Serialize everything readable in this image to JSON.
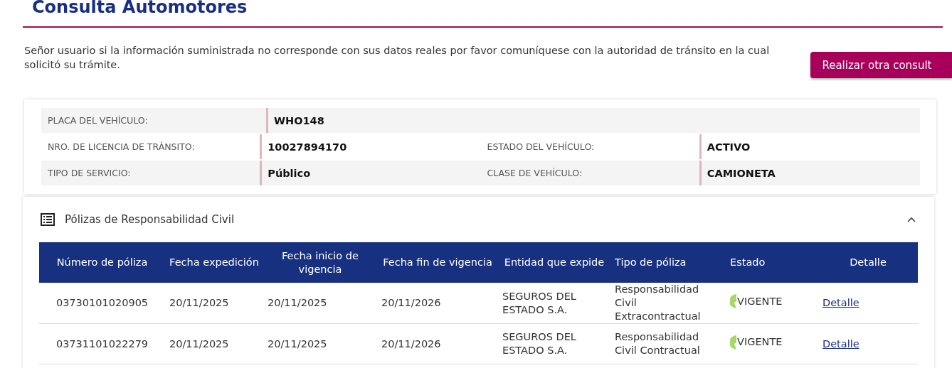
{
  "page_title": "Consulta Automotores",
  "notice": "Señor usuario si la información suministrada no corresponde con sus datos reales por favor comuníquese con la autoridad de tránsito en la cual solicitó su trámite.",
  "action_button": "Realizar otra consult",
  "vehicle_info": [
    [
      {
        "label": "PLACA DEL VEHÍCULO:",
        "value": "WHO148"
      }
    ],
    [
      {
        "label": "NRO. DE LICENCIA DE TRÁNSITO:",
        "value": "10027894170"
      },
      {
        "label": "ESTADO DEL VEHÍCULO:",
        "value": "ACTIVO"
      }
    ],
    [
      {
        "label": "TIPO DE SERVICIO:",
        "value": "Público"
      },
      {
        "label": "CLASE DE VEHÍCULO:",
        "value": "CAMIONETA"
      }
    ]
  ],
  "policies": {
    "title": "Pólizas de Responsabilidad Civil",
    "expanded": true,
    "columns": [
      "Número de póliza",
      "Fecha expedición",
      "Fecha inicio de vigencia",
      "Fecha fin de vigencia",
      "Entidad que expide",
      "Tipo de póliza",
      "Estado",
      "Detalle"
    ],
    "rows": [
      {
        "number": "03730101020905",
        "issued": "20/11/2025",
        "start": "20/11/2025",
        "end": "20/11/2026",
        "entity": "SEGUROS DEL ESTADO S.A.",
        "type": "Responsabilidad Civil Extracontractual",
        "status": "VIGENTE",
        "link": "Detalle"
      },
      {
        "number": "03731101022279",
        "issued": "20/11/2025",
        "start": "20/11/2025",
        "end": "20/11/2026",
        "entity": "SEGUROS DEL ESTADO S.A.",
        "type": "Responsabilidad Civil Contractual",
        "status": "VIGENTE",
        "link": "Detalle"
      }
    ]
  }
}
